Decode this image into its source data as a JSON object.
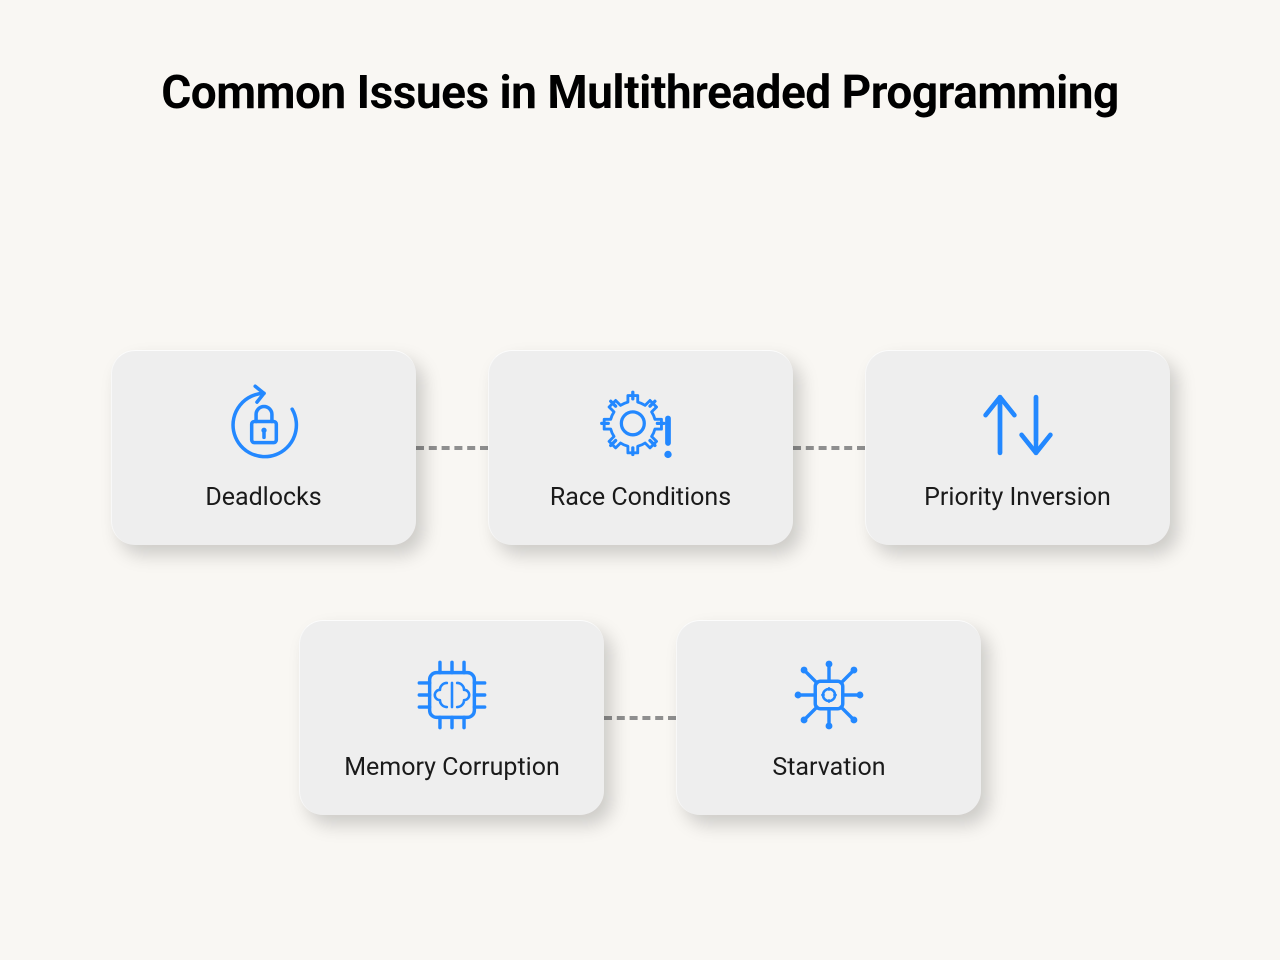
{
  "title": "Common Issues in Multithreaded Programming",
  "cards": {
    "deadlocks": {
      "label": "Deadlocks"
    },
    "race": {
      "label": "Race Conditions"
    },
    "priority": {
      "label": "Priority Inversion"
    },
    "memory": {
      "label": "Memory Corruption"
    },
    "starvation": {
      "label": "Starvation"
    }
  },
  "icon_color": "#2388ff"
}
